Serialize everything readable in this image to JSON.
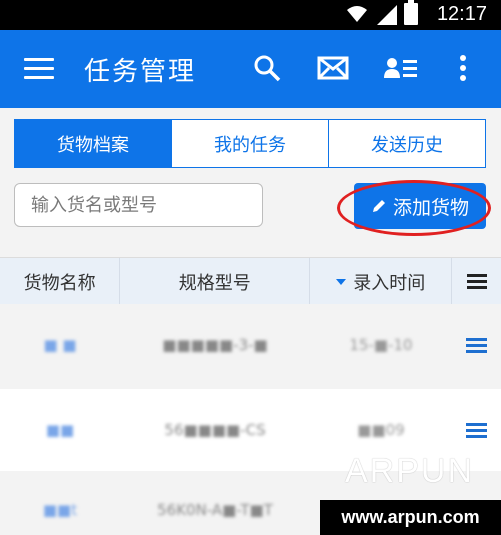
{
  "status_bar": {
    "time": "12:17"
  },
  "app_bar": {
    "title": "任务管理",
    "icons": [
      "menu-icon",
      "search-icon",
      "mail-icon",
      "contact-card-icon",
      "more-vert-icon"
    ]
  },
  "tabs": [
    {
      "label": "货物档案",
      "active": true
    },
    {
      "label": "我的任务",
      "active": false
    },
    {
      "label": "发送历史",
      "active": false
    }
  ],
  "search": {
    "placeholder": "输入货名或型号"
  },
  "add_button": {
    "label": "添加货物"
  },
  "table": {
    "columns": [
      "货物名称",
      "规格型号",
      "录入时间"
    ],
    "rows": [
      {
        "name": "■ ■",
        "model": "■■■■■-3-■",
        "time": "15-■-10"
      },
      {
        "name": "■■",
        "model": "56■■■■-CS",
        "time": "■■09"
      },
      {
        "name": "■■t",
        "model": "56K0N-A■-T■T",
        "time": ""
      }
    ]
  },
  "watermark": {
    "logo": "ARPUN",
    "url": "www.arpun.com"
  },
  "colors": {
    "primary": "#0e74e8",
    "highlight": "#e02020"
  }
}
